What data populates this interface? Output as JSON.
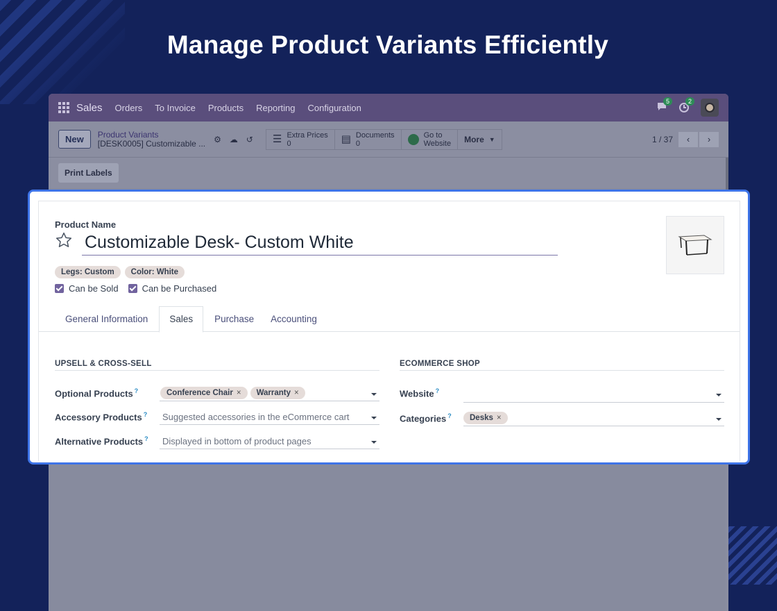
{
  "headline": "Manage Product Variants Efficiently",
  "navbar": {
    "brand": "Sales",
    "items": [
      "Orders",
      "To Invoice",
      "Products",
      "Reporting",
      "Configuration"
    ],
    "messages_count": "5",
    "activities_count": "2"
  },
  "control": {
    "new_label": "New",
    "breadcrumb_parent": "Product Variants",
    "breadcrumb_current": "[DESK0005] Customizable ...",
    "smart_buttons": [
      {
        "label": "Extra Prices",
        "value": "0"
      },
      {
        "label": "Documents",
        "value": "0"
      },
      {
        "label": "Go to",
        "value": "Website"
      }
    ],
    "more_label": "More",
    "pager": "1 / 37"
  },
  "actions": {
    "print_labels": "Print Labels"
  },
  "form": {
    "product_name_label": "Product Name",
    "product_name": "Customizable Desk- Custom White",
    "attribute_tags": [
      "Legs: Custom",
      "Color: White"
    ],
    "checks": [
      {
        "label": "Can be Sold",
        "checked": true
      },
      {
        "label": "Can be Purchased",
        "checked": true
      }
    ],
    "tabs": [
      "General Information",
      "Sales",
      "Purchase",
      "Accounting"
    ],
    "active_tab": "Sales",
    "upsell": {
      "title": "UPSELL & CROSS-SELL",
      "optional_label": "Optional Products",
      "optional_tags": [
        "Conference Chair",
        "Warranty"
      ],
      "accessory_label": "Accessory Products",
      "accessory_placeholder": "Suggested accessories in the eCommerce cart",
      "alternative_label": "Alternative Products",
      "alternative_placeholder": "Displayed in bottom of product pages"
    },
    "ecommerce": {
      "title": "ECOMMERCE SHOP",
      "website_label": "Website",
      "categories_label": "Categories",
      "category_tags": [
        "Desks"
      ]
    }
  },
  "colors": {
    "background": "#13225a",
    "accent": "#3e74e8",
    "brand_purple": "#71639e"
  }
}
